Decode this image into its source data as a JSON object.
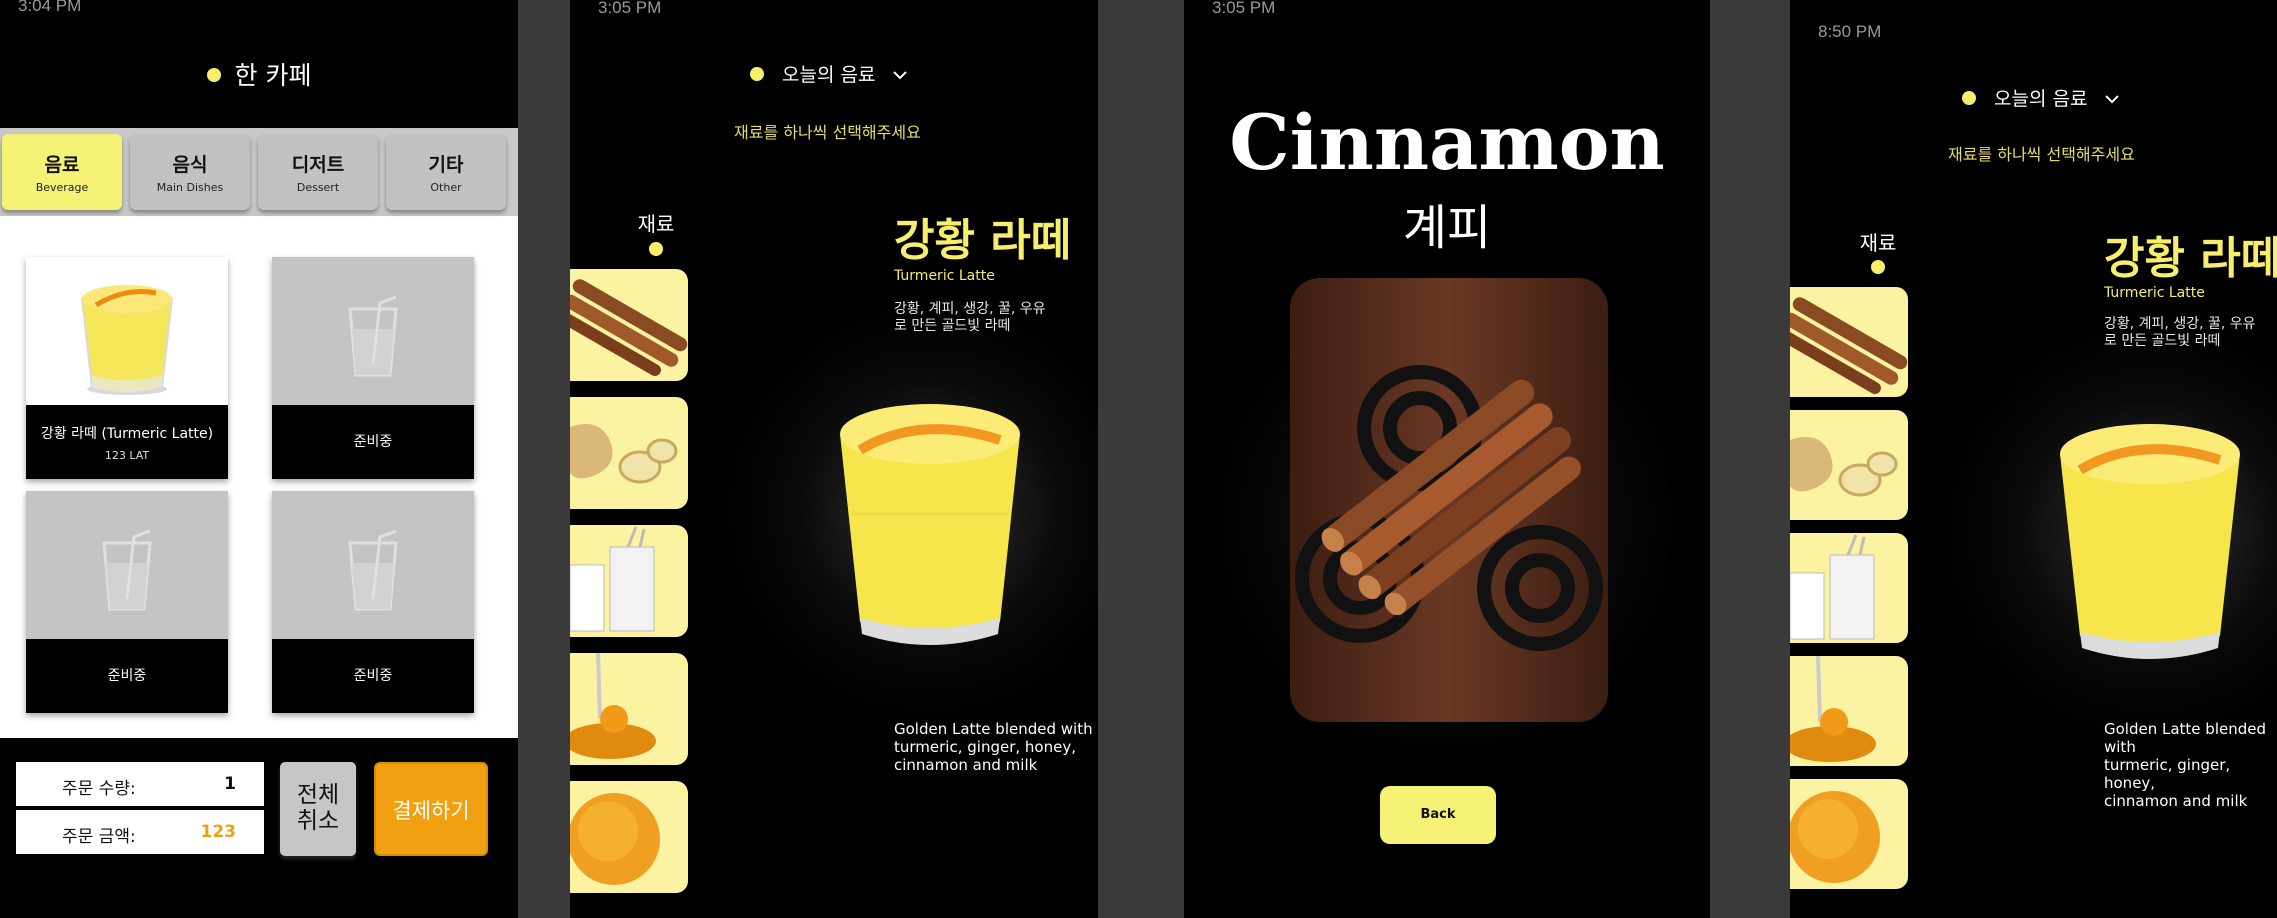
{
  "screen1": {
    "time": "3:04 PM",
    "cafe_name": "한 카페",
    "categories": [
      {
        "ko": "음료",
        "en": "Beverage"
      },
      {
        "ko": "음식",
        "en": "Main Dishes"
      },
      {
        "ko": "디저트",
        "en": "Dessert"
      },
      {
        "ko": "기타",
        "en": "Other"
      }
    ],
    "products": [
      {
        "name": "강황 라떼 (Turmeric Latte)",
        "price": "123 LAT"
      },
      {
        "name": "준비중"
      },
      {
        "name": "준비중"
      },
      {
        "name": "준비중"
      }
    ],
    "order_qty_label": "주문 수량:",
    "order_qty": "1",
    "order_total_label": "주문 금액:",
    "order_total": "123",
    "cancel_line1": "전체",
    "cancel_line2": "취소",
    "pay_label": "결제하기"
  },
  "screen2": {
    "time": "3:05 PM",
    "menu": "오늘의 음료",
    "hint": "재료를 하나씩 선택해주세요",
    "ingredients_label": "재료",
    "drink_name": "강황 라떼",
    "drink_en": "Turmeric Latte",
    "drink_ingredients_line1": "강황, 계피, 생강, 꿀, 우유",
    "drink_ingredients_line2": "로 만든 골드빛 라떼",
    "desc_line1": "Golden Latte blended with",
    "desc_line2": "turmeric, ginger, honey,",
    "desc_line3": "cinnamon and milk"
  },
  "screen3": {
    "time": "3:05 PM",
    "title_en": "Cinnamon",
    "title_ko": "계피",
    "back_label": "Back"
  },
  "screen4": {
    "time": "8:50 PM",
    "menu": "오늘의 음료",
    "hint": "재료를 하나씩 선택해주세요",
    "ingredients_label": "재료",
    "drink_name": "강황 라떼",
    "drink_en": "Turmeric Latte",
    "drink_ingredients_line1": "강황, 계피, 생강, 꿀, 우유",
    "drink_ingredients_line2": "로 만든 골드빛 라떼",
    "desc_line1": "Golden Latte blended with",
    "desc_line2": "turmeric, ginger, honey,",
    "desc_line3": "cinnamon and milk"
  },
  "ingredient_icons": [
    "cinnamon-icon",
    "ginger-icon",
    "milk-icon",
    "honey-icon",
    "turmeric-powder-icon"
  ],
  "colors": {
    "accent_yellow": "#f7ee6e",
    "pay_orange": "#f0a010",
    "tile_yellow": "#fbf3a2"
  }
}
